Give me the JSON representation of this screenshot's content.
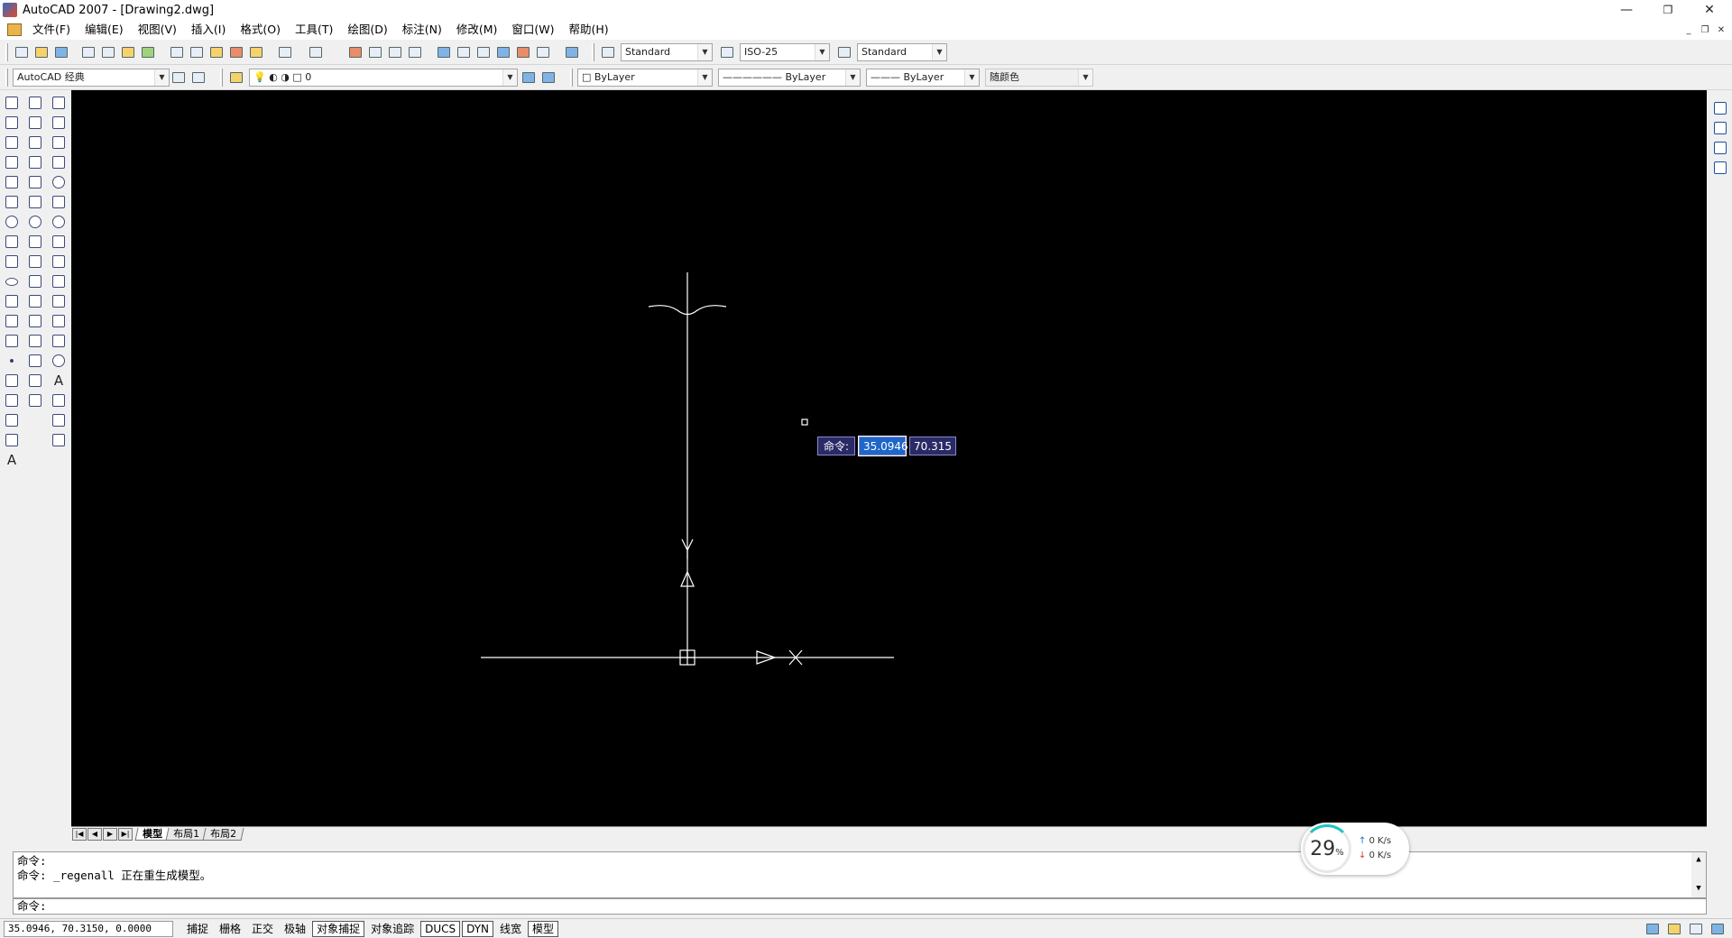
{
  "window": {
    "title": "AutoCAD 2007 - [Drawing2.dwg]",
    "minimize": "—",
    "restore": "❐",
    "close": "✕"
  },
  "menu": [
    "文件(F)",
    "编辑(E)",
    "视图(V)",
    "插入(I)",
    "格式(O)",
    "工具(T)",
    "绘图(D)",
    "标注(N)",
    "修改(M)",
    "窗口(W)",
    "帮助(H)"
  ],
  "styles": {
    "text_style": "Standard",
    "dim_style": "ISO-25",
    "table_style": "Standard"
  },
  "workspace": "AutoCAD 经典",
  "layer": "0",
  "properties": {
    "color": "ByLayer",
    "linetype": "ByLayer",
    "lineweight": "ByLayer",
    "plotstyle": "随颜色"
  },
  "dynamic_input": {
    "label": "命令:",
    "x": "35.0946",
    "y": "70.315"
  },
  "layout_tabs": [
    "模型",
    "布局1",
    "布局2"
  ],
  "command_history": [
    "命令:",
    "命令: _regenall 正在重生成模型。"
  ],
  "command_prompt": "命令:",
  "status": {
    "coords": "35.0946, 70.3150, 0.0000",
    "toggles": [
      {
        "label": "捕捉",
        "on": false
      },
      {
        "label": "栅格",
        "on": false
      },
      {
        "label": "正交",
        "on": false
      },
      {
        "label": "极轴",
        "on": false
      },
      {
        "label": "对象捕捉",
        "on": true
      },
      {
        "label": "对象追踪",
        "on": false
      },
      {
        "label": "DUCS",
        "on": true
      },
      {
        "label": "DYN",
        "on": true
      },
      {
        "label": "线宽",
        "on": false
      },
      {
        "label": "模型",
        "on": true
      }
    ]
  },
  "net_widget": {
    "percent": "29",
    "unit": "%",
    "up": "0 K/s",
    "down": "0 K/s"
  },
  "icons": [
    "line-icon",
    "polyline-icon",
    "polygon-icon",
    "rectangle-icon",
    "arc-icon",
    "circle-icon",
    "spline-icon",
    "ellipse-icon",
    "hatch-icon",
    "text-icon",
    "erase-icon",
    "copy-icon",
    "mirror-icon",
    "offset-icon",
    "array-icon",
    "move-icon",
    "rotate-icon",
    "scale-icon",
    "stretch-icon",
    "trim-icon",
    "extend-icon",
    "fillet-icon",
    "explode-icon",
    "dimension-icon"
  ]
}
